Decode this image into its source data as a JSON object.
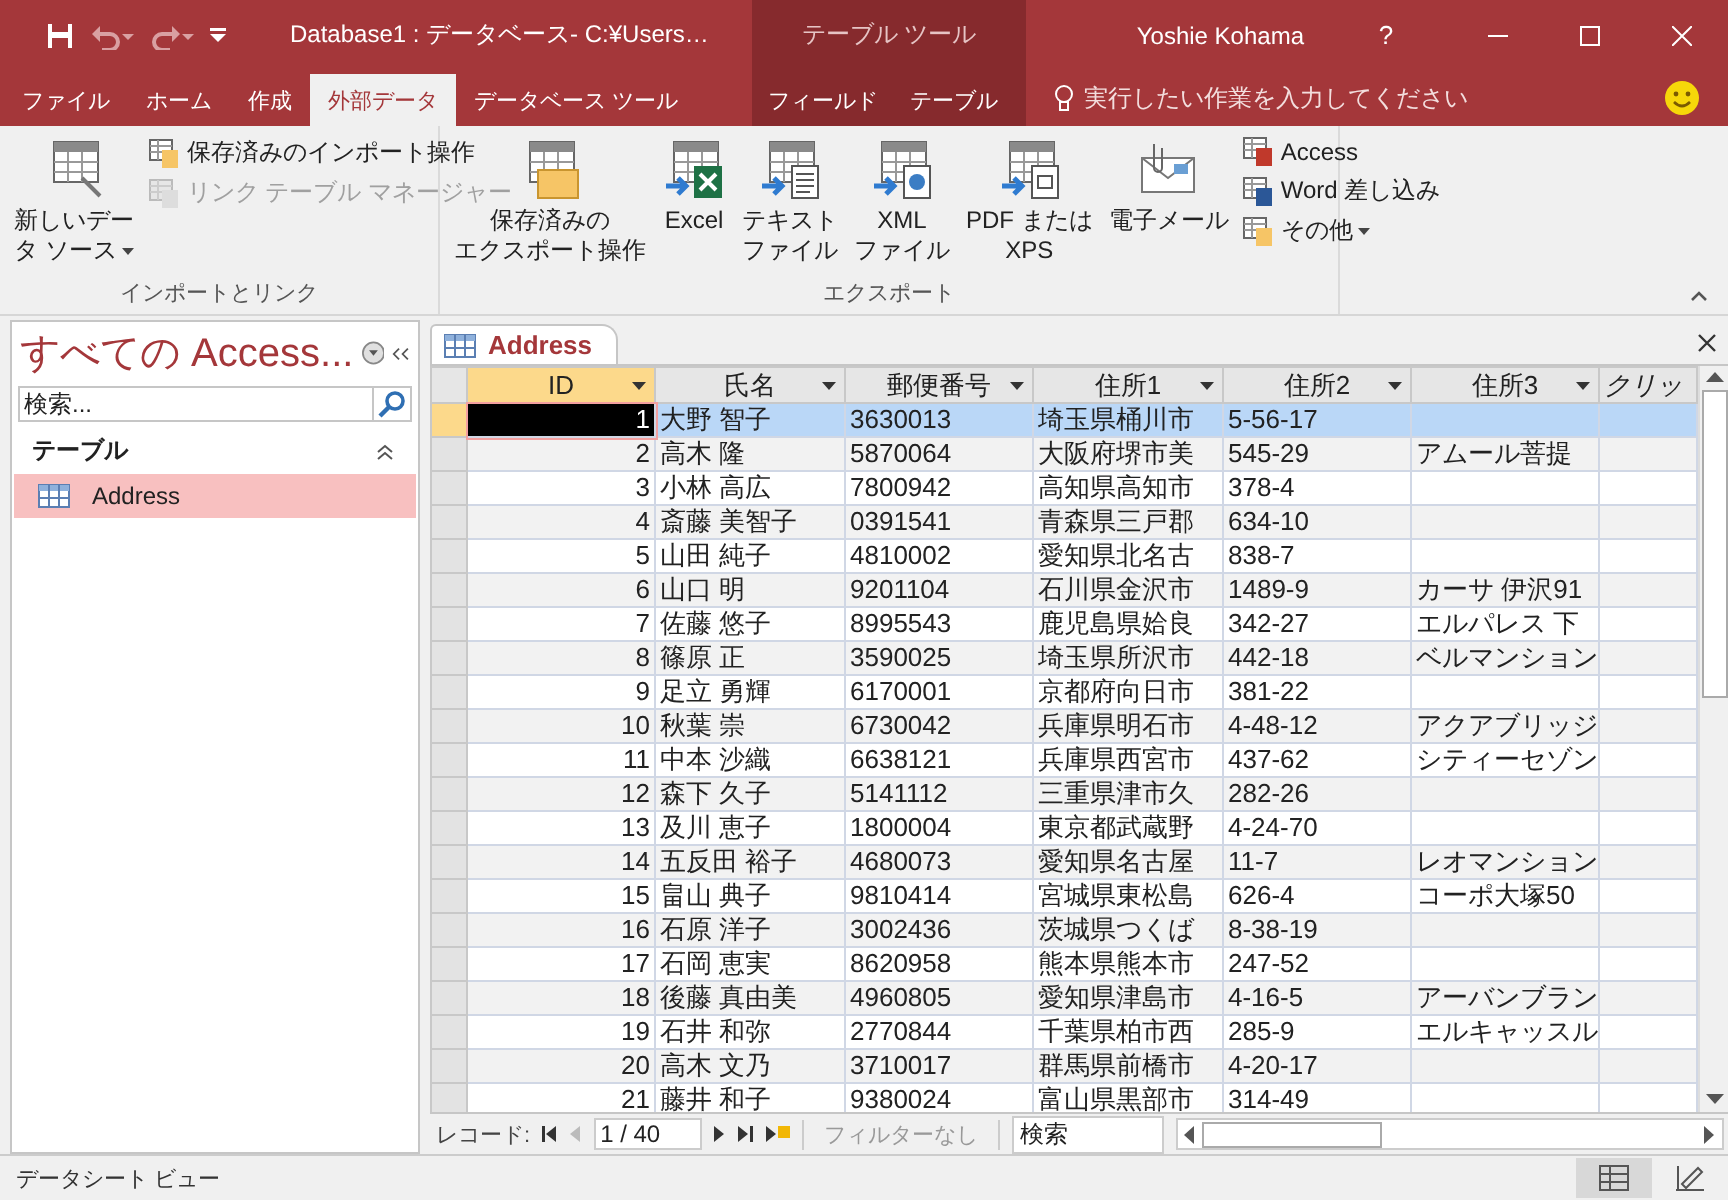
{
  "title_bar": {
    "title": "Database1 : データベース- C:¥Users…",
    "contextual_label": "テーブル ツール",
    "user": "Yoshie Kohama",
    "help": "?"
  },
  "ribbon_tabs": [
    {
      "label": "ファイル",
      "selected": false,
      "contextual": false
    },
    {
      "label": "ホーム",
      "selected": false,
      "contextual": false
    },
    {
      "label": "作成",
      "selected": false,
      "contextual": false
    },
    {
      "label": "外部データ",
      "selected": true,
      "contextual": false
    },
    {
      "label": "データベース ツール",
      "selected": false,
      "contextual": false
    },
    {
      "label": "フィールド",
      "selected": false,
      "contextual": true
    },
    {
      "label": "テーブル",
      "selected": false,
      "contextual": true
    }
  ],
  "tell_me": "実行したい作業を入力してください",
  "ribbon_groups": [
    {
      "label": "インポートとリンク",
      "large": [
        {
          "lines": [
            "新しいデー",
            "タ ソース"
          ],
          "has_menu": true,
          "disabled": false
        }
      ],
      "small": [
        {
          "label": "保存済みのインポート操作",
          "has_menu": false,
          "disabled": false
        },
        {
          "label": "リンク テーブル マネージャー",
          "has_menu": false,
          "disabled": true
        }
      ]
    },
    {
      "label": "エクスポート",
      "large": [
        {
          "lines": [
            "保存済みの",
            "エクスポート操作"
          ],
          "has_menu": false,
          "disabled": false
        },
        {
          "lines": [
            "Excel"
          ],
          "has_menu": false,
          "disabled": false
        },
        {
          "lines": [
            "テキスト",
            "ファイル"
          ],
          "has_menu": false,
          "disabled": false
        },
        {
          "lines": [
            "XML",
            "ファイル"
          ],
          "has_menu": false,
          "disabled": false
        },
        {
          "lines": [
            "PDF または",
            "XPS"
          ],
          "has_menu": false,
          "disabled": false
        },
        {
          "lines": [
            "電子メール"
          ],
          "has_menu": false,
          "disabled": false
        }
      ],
      "small": [
        {
          "label": "Access",
          "has_menu": false,
          "disabled": false
        },
        {
          "label": "Word 差し込み",
          "has_menu": false,
          "disabled": false
        },
        {
          "label": "その他",
          "has_menu": true,
          "disabled": false
        }
      ]
    }
  ],
  "nav_pane": {
    "title": "すべての Access...",
    "search_placeholder": "検索...",
    "group": "テーブル",
    "items": [
      {
        "label": "Address",
        "selected": true
      }
    ]
  },
  "document_tab": "Address",
  "table": {
    "columns": [
      {
        "label": "ID",
        "selected": true
      },
      {
        "label": "氏名",
        "selected": false
      },
      {
        "label": "郵便番号",
        "selected": false
      },
      {
        "label": "住所1",
        "selected": false
      },
      {
        "label": "住所2",
        "selected": false
      },
      {
        "label": "住所3",
        "selected": false
      },
      {
        "label": "クリッ",
        "selected": false
      }
    ],
    "rows": [
      {
        "selected": true,
        "cells": [
          "1",
          "大野 智子",
          "3630013",
          "埼玉県桶川市",
          "5-56-17",
          "",
          ""
        ]
      },
      {
        "selected": false,
        "cells": [
          "2",
          "高木 隆",
          "5870064",
          "大阪府堺市美",
          "545-29",
          "アムール菩提",
          ""
        ]
      },
      {
        "selected": false,
        "cells": [
          "3",
          "小林 高広",
          "7800942",
          "高知県高知市",
          "378-4",
          "",
          ""
        ]
      },
      {
        "selected": false,
        "cells": [
          "4",
          "斎藤 美智子",
          "0391541",
          "青森県三戸郡",
          "634-10",
          "",
          ""
        ]
      },
      {
        "selected": false,
        "cells": [
          "5",
          "山田 純子",
          "4810002",
          "愛知県北名古",
          "838-7",
          "",
          ""
        ]
      },
      {
        "selected": false,
        "cells": [
          "6",
          "山口 明",
          "9201104",
          "石川県金沢市",
          "1489-9",
          "カーサ 伊沢91",
          ""
        ]
      },
      {
        "selected": false,
        "cells": [
          "7",
          "佐藤 悠子",
          "8995543",
          "鹿児島県姶良",
          "342-27",
          "エルパレス 下",
          ""
        ]
      },
      {
        "selected": false,
        "cells": [
          "8",
          "篠原 正",
          "3590025",
          "埼玉県所沢市",
          "442-18",
          "ベルマンション",
          ""
        ]
      },
      {
        "selected": false,
        "cells": [
          "9",
          "足立 勇輝",
          "6170001",
          "京都府向日市",
          "381-22",
          "",
          ""
        ]
      },
      {
        "selected": false,
        "cells": [
          "10",
          "秋葉 崇",
          "6730042",
          "兵庫県明石市",
          "4-48-12",
          "アクアブリッジ",
          ""
        ]
      },
      {
        "selected": false,
        "cells": [
          "11",
          "中本 沙織",
          "6638121",
          "兵庫県西宮市",
          "437-62",
          "シティーセゾン",
          ""
        ]
      },
      {
        "selected": false,
        "cells": [
          "12",
          "森下 久子",
          "5141112",
          "三重県津市久",
          "282-26",
          "",
          ""
        ]
      },
      {
        "selected": false,
        "cells": [
          "13",
          "及川 恵子",
          "1800004",
          "東京都武蔵野",
          "4-24-70",
          "",
          ""
        ]
      },
      {
        "selected": false,
        "cells": [
          "14",
          "五反田 裕子",
          "4680073",
          "愛知県名古屋",
          "11-7",
          "レオマンション",
          ""
        ]
      },
      {
        "selected": false,
        "cells": [
          "15",
          "畠山 典子",
          "9810414",
          "宮城県東松島",
          "626-4",
          "コーポ大塚50",
          ""
        ]
      },
      {
        "selected": false,
        "cells": [
          "16",
          "石原 洋子",
          "3002436",
          "茨城県つくば",
          "8-38-19",
          "",
          ""
        ]
      },
      {
        "selected": false,
        "cells": [
          "17",
          "石岡 恵実",
          "8620958",
          "熊本県熊本市",
          "247-52",
          "",
          ""
        ]
      },
      {
        "selected": false,
        "cells": [
          "18",
          "後藤 真由美",
          "4960805",
          "愛知県津島市",
          "4-16-5",
          "アーバンブラン",
          ""
        ]
      },
      {
        "selected": false,
        "cells": [
          "19",
          "石井 和弥",
          "2770844",
          "千葉県柏市西",
          "285-9",
          "エルキャッスル",
          ""
        ]
      },
      {
        "selected": false,
        "cells": [
          "20",
          "高木 文乃",
          "3710017",
          "群馬県前橋市",
          "4-20-17",
          "",
          ""
        ]
      },
      {
        "selected": false,
        "cells": [
          "21",
          "藤井 和子",
          "9380024",
          "富山県黒部市",
          "314-49",
          "",
          ""
        ]
      }
    ]
  },
  "record_nav": {
    "label": "レコード:",
    "position": "1 / 40",
    "filter": "フィルターなし",
    "search": "検索"
  },
  "status_bar": "データシート ビュー"
}
